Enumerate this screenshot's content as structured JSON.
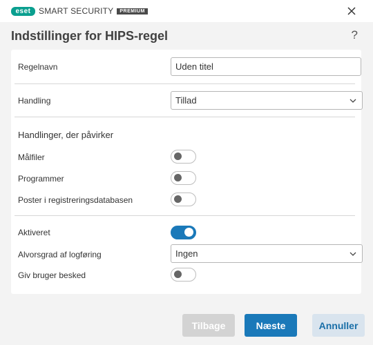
{
  "titlebar": {
    "logo_text": "eset",
    "product_name": "SMART SECURITY",
    "edition": "PREMIUM"
  },
  "header": {
    "title": "Indstillinger for HIPS-regel",
    "help": "?"
  },
  "form": {
    "rule_name": {
      "label": "Regelnavn",
      "value": "Uden titel"
    },
    "action": {
      "label": "Handling",
      "value": "Tillad"
    },
    "affects": {
      "heading": "Handlinger, der påvirker",
      "items": [
        {
          "label": "Målfiler",
          "enabled": false
        },
        {
          "label": "Programmer",
          "enabled": false
        },
        {
          "label": "Poster i registreringsdatabasen",
          "enabled": false
        }
      ]
    },
    "enabled": {
      "label": "Aktiveret",
      "enabled": true
    },
    "log_severity": {
      "label": "Alvorsgrad af logføring",
      "value": "Ingen"
    },
    "notify_user": {
      "label": "Giv bruger besked",
      "enabled": false
    }
  },
  "footer": {
    "back_label": "Tilbage",
    "next_label": "Næste",
    "cancel_label": "Annuller"
  },
  "colors": {
    "accent": "#1a79b9",
    "logo": "#0a9f8f",
    "background": "#f3f3f3",
    "disabled_button": "#d3d3d3"
  }
}
